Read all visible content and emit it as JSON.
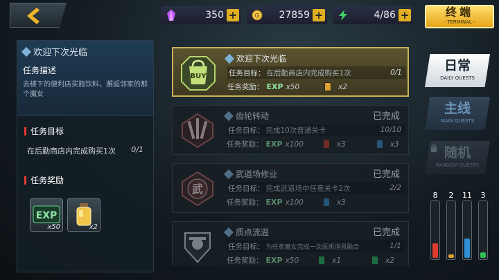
{
  "resources": {
    "crystal": {
      "value": "350",
      "icon": "crystal-icon",
      "color": "#c25cff"
    },
    "coin": {
      "value": "27859",
      "icon": "coin-icon",
      "color": "#f2c84b"
    },
    "energy": {
      "value": "4/86",
      "icon": "energy-icon",
      "color": "#3fd46a"
    },
    "plus": "+"
  },
  "terminal": {
    "label": "终端",
    "sub": "- TERMINAL -"
  },
  "detail": {
    "title": "欢迎下次光临",
    "desc_heading": "任务描述",
    "desc": "去楼下的便利店买瓶饮料，邂逅邻家的那个魔女",
    "goal_heading": "任务目标",
    "goal_text": "在后勤商店内完成购买1次",
    "goal_progress": "0/1",
    "reward_heading": "任务奖励",
    "rewards": [
      {
        "icon": "exp-icon",
        "label": "EXP",
        "count": "x50"
      },
      {
        "icon": "potion-icon",
        "count": "x2"
      }
    ]
  },
  "quests": [
    {
      "name": "欢迎下次光临",
      "status": "",
      "goal_label": "任务目标：",
      "goal": "在后勤商店内完成购买1次",
      "progress": "0/1",
      "reward_label": "任务奖励：",
      "exp": "EXP",
      "exp_count": "x50",
      "items": [
        {
          "count": "x2",
          "color": "#e0a030"
        }
      ],
      "icon": "buy-bag-icon",
      "badge": "BUY"
    },
    {
      "name": "齿轮转动",
      "status": "已完成",
      "goal_label": "任务目标：",
      "goal": "完成10次普通关卡",
      "progress": "10/10",
      "reward_label": "任务奖励：",
      "exp": "EXP",
      "exp_count": "x100",
      "items": [
        {
          "count": "x3",
          "color": "#c0392b"
        },
        {
          "count": "x3",
          "color": "#2e86c1"
        }
      ],
      "icon": "swords-emblem-icon"
    },
    {
      "name": "武道场修业",
      "status": "已完成",
      "goal_label": "任务目标：",
      "goal": "完成武道场中任意关卡2次",
      "progress": "2/2",
      "reward_label": "任务奖励：",
      "exp": "EXP",
      "exp_count": "x100",
      "items": [
        {
          "count": "x3",
          "color": "#2e86c1"
        }
      ],
      "icon": "martial-emblem-icon",
      "badge": "武"
    },
    {
      "name": "质点流溢",
      "status": "已完成",
      "goal_label": "任务目标：",
      "goal": "为任意魔女完成一次原质道具融合",
      "progress": "1/1",
      "reward_label": "任务奖励：",
      "exp": "EXP",
      "exp_count": "x50",
      "items": [
        {
          "count": "x1",
          "color": "#27ae60"
        },
        {
          "count": "x2",
          "color": "#27ae60"
        }
      ],
      "icon": "shield-emblem-icon"
    }
  ],
  "tabs": [
    {
      "label": "日常",
      "sub": "DAILY QUESTS",
      "state": "active"
    },
    {
      "label": "主线",
      "sub": "MAIN QUESTS",
      "state": "normal"
    },
    {
      "label": "随机",
      "sub": "RANDOM QUESTS",
      "state": "locked"
    }
  ],
  "gauges": [
    {
      "value": "8",
      "level": 0.25,
      "color": "#e03b2e"
    },
    {
      "value": "2",
      "level": 0.06,
      "color": "#e0a030"
    },
    {
      "value": "11",
      "level": 0.33,
      "color": "#2e8fd6"
    },
    {
      "value": "3",
      "level": 0.09,
      "color": "#2fbf55"
    }
  ]
}
